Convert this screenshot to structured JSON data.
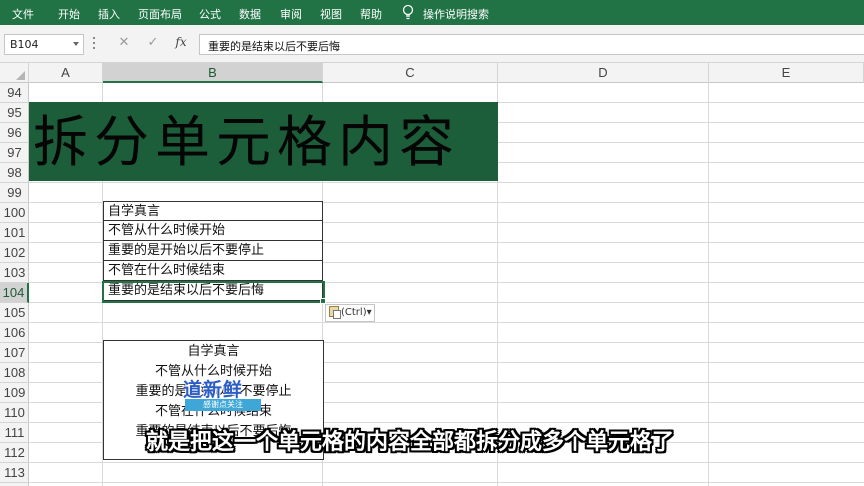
{
  "ribbon": {
    "tabs": [
      "文件",
      "开始",
      "插入",
      "页面布局",
      "公式",
      "数据",
      "审阅",
      "视图",
      "帮助"
    ],
    "tell_me": "操作说明搜索",
    "bg_color": "#217346"
  },
  "formula_bar": {
    "name_box": "B104",
    "cancel_icon": "✕",
    "enter_icon": "✓",
    "fx_label": "fx",
    "value": "重要的是结束以后不要后悔"
  },
  "columns": [
    "A",
    "B",
    "C",
    "D",
    "E"
  ],
  "rows": [
    "94",
    "95",
    "96",
    "97",
    "98",
    "99",
    "100",
    "101",
    "102",
    "103",
    "104",
    "105",
    "106",
    "107",
    "108",
    "109",
    "110",
    "111",
    "112",
    "113"
  ],
  "selected": {
    "column": "B",
    "row": "104"
  },
  "banner": {
    "text": "拆分单元格内容",
    "color": "#1d5e3a"
  },
  "table1": [
    "自学真言",
    "不管从什么时候开始",
    "重要的是开始以后不要停止",
    "不管在什么时候结束",
    "重要的是结束以后不要后悔"
  ],
  "paste_options": {
    "label": "(Ctrl)",
    "caret": "▾"
  },
  "table2": [
    "自学真言",
    "不管从什么时候开始",
    "重要的是开始以后不要停止",
    "不管在什么时候结束",
    "重要的是结束以后不要后悔"
  ],
  "watermark": {
    "title": "道新鲜",
    "subtitle": "感谢点关注"
  },
  "subtitle": "就是把这一个单元格的内容全部都拆分成多个单元格了"
}
